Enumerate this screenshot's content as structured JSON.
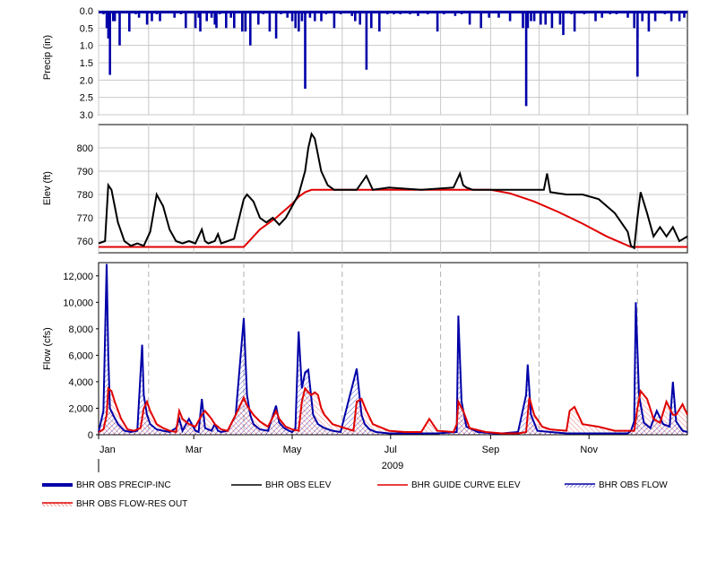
{
  "chart_data": [
    {
      "type": "bar",
      "ylabel": "Precip (in)",
      "ylim": [
        3.0,
        0.0
      ],
      "yticks": [
        "0.0",
        "0.5",
        "1.0",
        "1.5",
        "2.0",
        "2.5",
        "3.0"
      ],
      "inverted": true,
      "x_days": [
        3,
        5,
        6,
        7,
        9,
        10,
        13,
        19,
        23,
        25,
        30,
        33,
        36,
        38,
        47,
        51,
        54,
        60,
        62,
        63,
        67,
        70,
        72,
        73,
        75,
        79,
        82,
        84,
        89,
        91,
        94,
        99,
        102,
        106,
        110,
        113,
        117,
        120,
        122,
        124,
        126,
        128,
        131,
        134,
        138,
        141,
        146,
        150,
        157,
        159,
        162,
        166,
        169,
        174,
        179,
        183,
        187,
        193,
        198,
        204,
        210,
        214,
        221,
        225,
        230,
        237,
        242,
        248,
        255,
        263,
        266,
        268,
        270,
        274,
        277,
        281,
        286,
        288,
        293,
        301,
        308,
        312,
        317,
        321,
        328,
        332,
        334,
        337,
        341,
        345,
        351,
        355,
        360,
        363
      ],
      "values": [
        0.1,
        0.5,
        0.8,
        1.85,
        0.3,
        0.3,
        1.0,
        0.6,
        0.1,
        0.2,
        0.4,
        0.3,
        0.1,
        0.3,
        0.2,
        0.1,
        0.5,
        0.5,
        0.2,
        0.6,
        0.3,
        0.2,
        0.4,
        0.5,
        0.1,
        0.5,
        0.2,
        0.5,
        0.6,
        0.6,
        1.0,
        0.4,
        0.1,
        0.6,
        0.8,
        0.1,
        0.2,
        0.3,
        0.5,
        0.6,
        0.3,
        0.1,
        0.2,
        0.3,
        0.3,
        0.1,
        0.5,
        0.1,
        0.15,
        0.3,
        0.4,
        1.7,
        0.5,
        0.6,
        0.1,
        0.1,
        0.1,
        0.1,
        0.15,
        0.1,
        0.6,
        0.1,
        0.15,
        0.1,
        0.4,
        0.5,
        0.2,
        0.2,
        0.3,
        0.5,
        0.5,
        0.3,
        0.3,
        0.4,
        0.4,
        0.5,
        0.4,
        0.7,
        0.1,
        0.1,
        0.3,
        0.2,
        0.1,
        0.1,
        0.2,
        0.5,
        0.8,
        0.3,
        0.6,
        0.3,
        0.1,
        0.3,
        0.3,
        0.2
      ],
      "extra_peaks": {
        "x": [
          128,
          265,
          295,
          334
        ],
        "values": [
          2.25,
          2.75,
          0.6,
          1.9
        ]
      },
      "series_name": "BHR OBS PRECIP-INC",
      "color": "#0000a8"
    },
    {
      "type": "line",
      "ylabel": "Elev (ft)",
      "ylim": [
        755,
        810
      ],
      "yticks": [
        "760",
        "770",
        "780",
        "790",
        "800"
      ],
      "series": [
        {
          "name": "BHR OBS ELEV",
          "color": "#000000",
          "x": [
            0,
            4,
            6,
            8,
            12,
            16,
            20,
            24,
            28,
            32,
            36,
            40,
            44,
            48,
            52,
            56,
            60,
            64,
            66,
            68,
            72,
            74,
            76,
            80,
            84,
            90,
            92,
            96,
            100,
            104,
            108,
            112,
            116,
            120,
            124,
            128,
            130,
            132,
            134,
            138,
            142,
            146,
            150,
            160,
            166,
            170,
            180,
            200,
            220,
            224,
            226,
            228,
            232,
            240,
            250,
            260,
            270,
            276,
            278,
            280,
            290,
            300,
            310,
            320,
            328,
            330,
            332,
            334,
            336,
            340,
            344,
            348,
            352,
            356,
            360,
            365
          ],
          "y": [
            759,
            760,
            784,
            782,
            768,
            760,
            758,
            759,
            758,
            764,
            780,
            775,
            765,
            760,
            759,
            760,
            759,
            765,
            760,
            759,
            760,
            763,
            759,
            760,
            761,
            778,
            780,
            777,
            770,
            768,
            770,
            767,
            770,
            775,
            780,
            790,
            800,
            806,
            804,
            790,
            784,
            782,
            782,
            782,
            788,
            782,
            783,
            782,
            783,
            789,
            784,
            783,
            782,
            782,
            782,
            782,
            782,
            782,
            789,
            781,
            780,
            780,
            778,
            772,
            764,
            758,
            757,
            770,
            781,
            772,
            762,
            766,
            762,
            766,
            760,
            762
          ]
        },
        {
          "name": "BHR GUIDE CURVE ELEV",
          "color": "#e00000",
          "x": [
            0,
            90,
            100,
            110,
            120,
            124,
            128,
            132,
            140,
            160,
            200,
            240,
            243,
            255,
            270,
            285,
            300,
            315,
            330,
            335,
            345,
            365
          ],
          "y": [
            757.5,
            757.5,
            765,
            770,
            776,
            779,
            781,
            782,
            782,
            782,
            782,
            782,
            782,
            780.5,
            777,
            772.5,
            767.5,
            762,
            757.5,
            757.5,
            757.5,
            757.5
          ]
        }
      ]
    },
    {
      "type": "area",
      "ylabel": "Flow (cfs)",
      "ylim": [
        0,
        13000
      ],
      "yticks": [
        "0",
        "2,000",
        "4,000",
        "6,000",
        "8,000",
        "10,000",
        "12,000"
      ],
      "xlabel": "2009",
      "xticks": [
        "Jan",
        "Mar",
        "May",
        "Jul",
        "Sep",
        "Nov"
      ],
      "xtick_days": [
        0,
        59,
        120,
        181,
        243,
        304
      ],
      "series": [
        {
          "name": "BHR OBS FLOW",
          "color": "#0000a8",
          "x": [
            0,
            3,
            5,
            6,
            7,
            9,
            12,
            16,
            20,
            24,
            27,
            28,
            30,
            32,
            36,
            40,
            44,
            48,
            50,
            52,
            56,
            60,
            62,
            64,
            66,
            70,
            72,
            74,
            76,
            80,
            85,
            90,
            92,
            94,
            96,
            100,
            105,
            110,
            112,
            115,
            118,
            120,
            122,
            124,
            126,
            128,
            130,
            133,
            136,
            140,
            145,
            150,
            160,
            163,
            165,
            168,
            172,
            180,
            190,
            200,
            210,
            222,
            223,
            225,
            228,
            235,
            245,
            250,
            260,
            265,
            266,
            268,
            272,
            280,
            290,
            300,
            310,
            320,
            328,
            330,
            332,
            333,
            335,
            338,
            342,
            346,
            350,
            354,
            356,
            358,
            362,
            365
          ],
          "y": [
            200,
            1800,
            12900,
            6000,
            2000,
            1500,
            800,
            300,
            200,
            300,
            6800,
            3000,
            1500,
            800,
            400,
            300,
            200,
            500,
            1200,
            300,
            1200,
            300,
            200,
            2700,
            500,
            300,
            800,
            300,
            200,
            300,
            1500,
            8800,
            3000,
            1500,
            800,
            400,
            300,
            2200,
            900,
            500,
            300,
            200,
            500,
            7800,
            3500,
            4700,
            4900,
            1500,
            800,
            500,
            300,
            200,
            5000,
            1500,
            800,
            400,
            200,
            100,
            100,
            100,
            100,
            200,
            9000,
            2500,
            600,
            200,
            100,
            100,
            200,
            3000,
            5300,
            1500,
            300,
            200,
            100,
            100,
            100,
            100,
            100,
            300,
            1000,
            10000,
            3000,
            900,
            500,
            1800,
            800,
            600,
            4000,
            1000,
            300,
            200
          ]
        },
        {
          "name": "BHR OBS FLOW-RES OUT",
          "color": "#e00000",
          "x": [
            0,
            3,
            5,
            6,
            8,
            10,
            14,
            18,
            22,
            26,
            28,
            30,
            32,
            36,
            40,
            44,
            48,
            50,
            52,
            56,
            60,
            64,
            66,
            70,
            72,
            76,
            80,
            85,
            90,
            92,
            96,
            100,
            105,
            110,
            112,
            116,
            120,
            124,
            126,
            128,
            130,
            132,
            134,
            136,
            138,
            140,
            145,
            150,
            158,
            160,
            163,
            166,
            170,
            180,
            190,
            200,
            205,
            210,
            220,
            222,
            223,
            226,
            230,
            240,
            250,
            260,
            265,
            267,
            270,
            275,
            280,
            290,
            292,
            295,
            300,
            310,
            320,
            330,
            332,
            334,
            336,
            340,
            344,
            348,
            352,
            356,
            358,
            362,
            365
          ],
          "y": [
            200,
            400,
            1500,
            3500,
            3300,
            2500,
            1200,
            400,
            300,
            500,
            2000,
            2500,
            1800,
            800,
            500,
            300,
            200,
            1800,
            1200,
            800,
            600,
            1500,
            1800,
            1200,
            800,
            400,
            300,
            1500,
            2800,
            2200,
            1500,
            1000,
            600,
            1800,
            1200,
            600,
            400,
            300,
            2500,
            3500,
            3200,
            3000,
            3200,
            3000,
            2000,
            1500,
            800,
            600,
            300,
            2500,
            2700,
            1800,
            800,
            300,
            200,
            200,
            1200,
            300,
            200,
            800,
            2500,
            1800,
            500,
            200,
            100,
            100,
            200,
            2800,
            1500,
            600,
            400,
            300,
            1800,
            2100,
            800,
            600,
            300,
            300,
            300,
            2000,
            3300,
            2700,
            1200,
            900,
            2500,
            1500,
            1500,
            2300,
            1500
          ]
        }
      ]
    }
  ],
  "legend": {
    "items": [
      {
        "label": "BHR OBS PRECIP-INC",
        "color": "#0000a8"
      },
      {
        "label": "BHR OBS ELEV",
        "color": "#000000"
      },
      {
        "label": "BHR GUIDE CURVE ELEV",
        "color": "#e00000"
      },
      {
        "label": "BHR OBS FLOW",
        "color": "#0000a8"
      },
      {
        "label": "BHR OBS FLOW-RES OUT",
        "color": "#e00000"
      }
    ]
  }
}
